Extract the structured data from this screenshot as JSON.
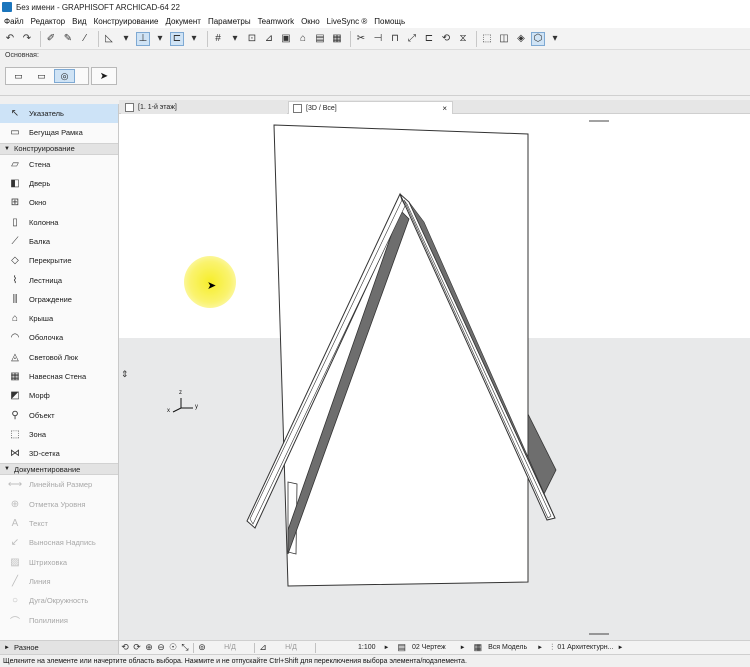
{
  "window": {
    "title": "Без имени - GRAPHISOFT ARCHICAD-64 22"
  },
  "menu": [
    "Файл",
    "Редактор",
    "Вид",
    "Конструирование",
    "Документ",
    "Параметры",
    "Teamwork",
    "Окно",
    "LiveSync ®",
    "Помощь"
  ],
  "infobox": {
    "label": "Основная:"
  },
  "tabs": [
    {
      "label": "[1. 1-й этаж]"
    },
    {
      "label": "[3D / Все]"
    }
  ],
  "toolbox": {
    "top_items": [
      {
        "label": "Указатель",
        "icon": "pointer-arrow-icon"
      },
      {
        "label": "Бегущая Рамка",
        "icon": "marquee-icon"
      }
    ],
    "sections": {
      "design": "Конструирование",
      "documentation": "Документирование",
      "more": "Разное"
    },
    "design_items": [
      {
        "label": "Стена",
        "icon": "wall-icon"
      },
      {
        "label": "Дверь",
        "icon": "door-icon"
      },
      {
        "label": "Окно",
        "icon": "window-icon"
      },
      {
        "label": "Колонна",
        "icon": "column-icon"
      },
      {
        "label": "Балка",
        "icon": "beam-icon"
      },
      {
        "label": "Перекрытие",
        "icon": "slab-icon"
      },
      {
        "label": "Лестница",
        "icon": "stair-icon"
      },
      {
        "label": "Ограждение",
        "icon": "railing-icon"
      },
      {
        "label": "Крыша",
        "icon": "roof-icon"
      },
      {
        "label": "Оболочка",
        "icon": "shell-icon"
      },
      {
        "label": "Световой Люк",
        "icon": "skylight-icon"
      },
      {
        "label": "Навесная Стена",
        "icon": "curtain-wall-icon"
      },
      {
        "label": "Морф",
        "icon": "morph-icon"
      },
      {
        "label": "Объект",
        "icon": "object-icon"
      },
      {
        "label": "Зона",
        "icon": "zone-icon"
      },
      {
        "label": "3D-сетка",
        "icon": "mesh-icon"
      }
    ],
    "documentation_items": [
      {
        "label": "Линейный Размер",
        "icon": "dimension-icon"
      },
      {
        "label": "Отметка Уровня",
        "icon": "level-dimension-icon"
      },
      {
        "label": "Текст",
        "icon": "text-icon"
      },
      {
        "label": "Выносная Надпись",
        "icon": "label-icon"
      },
      {
        "label": "Штриховка",
        "icon": "fill-icon"
      },
      {
        "label": "Линия",
        "icon": "line-icon"
      },
      {
        "label": "Дуга/Окружность",
        "icon": "arc-icon"
      },
      {
        "label": "Полилиния",
        "icon": "polyline-icon"
      }
    ]
  },
  "navbar": {
    "na1": "Н/Д",
    "na2": "Н/Д",
    "scale": "1:100",
    "layout": "02 Чертеж",
    "model": "Вся Модель",
    "renovation": "01 Архитектурн..."
  },
  "axes": {
    "x": "x",
    "y": "y",
    "z": "z"
  },
  "status": "Щелкните на элементе или начертите область выбора. Нажмите и не отпускайте Ctrl+Shift для переключения выбора элемента/подэлемента.",
  "colors": {
    "selection": "#cde3f7",
    "accent": "#1b75bc",
    "roof_shadow": "#6e6e6e",
    "highlight": "#f6ee2a"
  }
}
